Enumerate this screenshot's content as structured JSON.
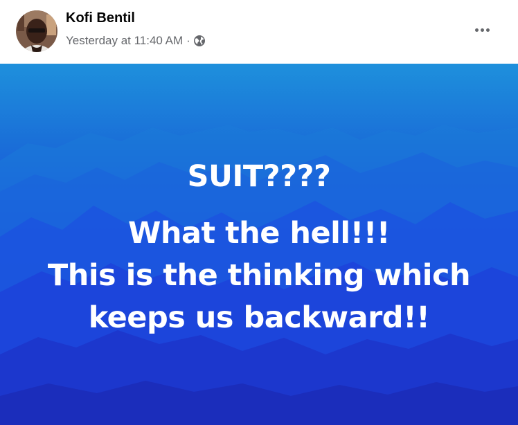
{
  "post": {
    "author": {
      "name": "Kofi Bentil",
      "avatar_icon": "profile-photo"
    },
    "timestamp": "Yesterday at 11:40 AM",
    "separator": "·",
    "audience_icon": "globe-icon",
    "more_icon": "more-options-icon",
    "banner": {
      "background_colors": [
        "#1e90dc",
        "#1b4ee0",
        "#1c30c2"
      ],
      "lines": [
        "SUIT????",
        "What the hell!!!",
        "This is the thinking which",
        "keeps us backward!!"
      ]
    }
  }
}
